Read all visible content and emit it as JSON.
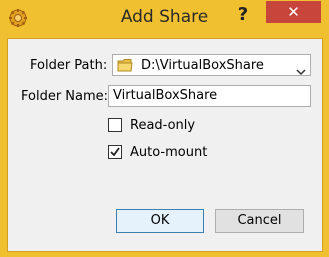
{
  "window": {
    "title": "Add Share",
    "help_label": "?",
    "close_label": "✕"
  },
  "form": {
    "folder_path_label": "Folder Path:",
    "folder_path_value": "D:\\VirtualBoxShare",
    "folder_name_label": "Folder Name:",
    "folder_name_value": "VirtualBoxShare",
    "readonly_label": "Read-only",
    "readonly_checked": false,
    "automount_label": "Auto-mount",
    "automount_checked": true
  },
  "buttons": {
    "ok_label": "OK",
    "cancel_label": "Cancel"
  },
  "icons": {
    "app": "virtualbox-gear-icon",
    "folder": "folder-icon",
    "dropdown": "chevron-down-icon"
  },
  "colors": {
    "title_bar": "#f0c030",
    "close_button": "#c7453b"
  }
}
